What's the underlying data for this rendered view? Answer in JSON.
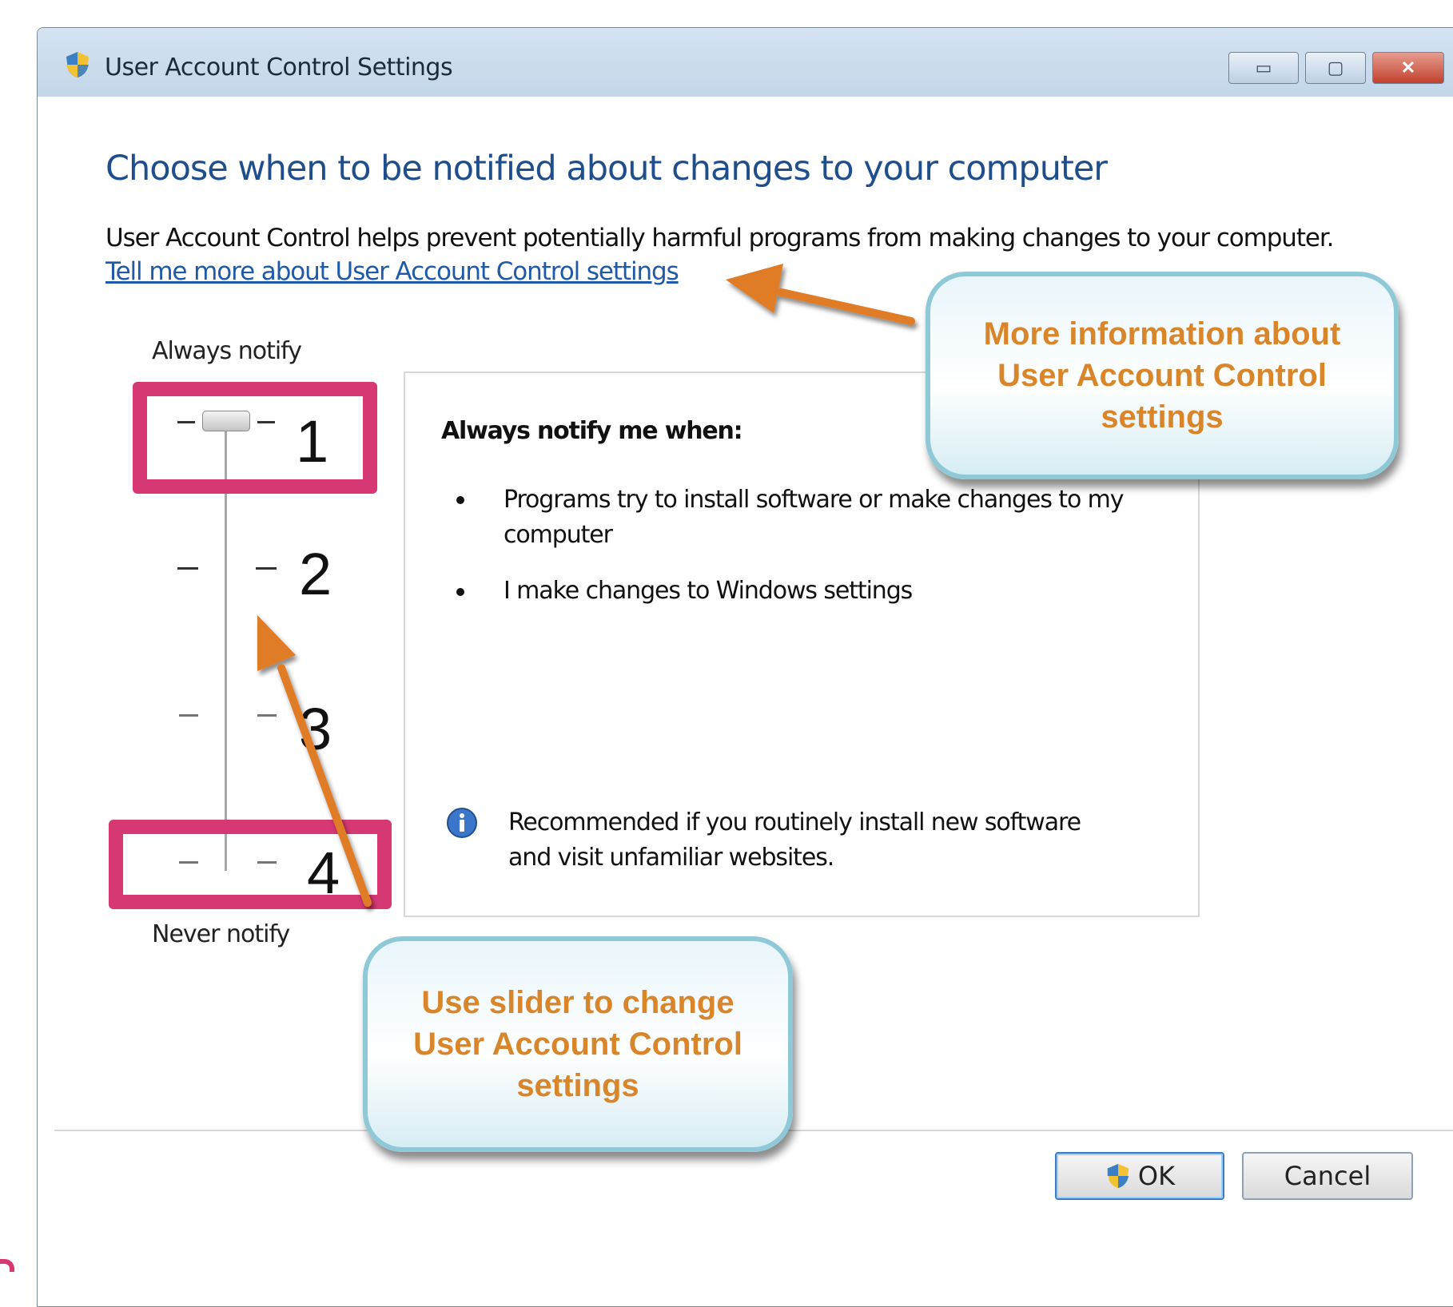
{
  "window": {
    "title": "User Account Control Settings",
    "controls": {
      "minimize": "▭",
      "maximize": "▢",
      "close": "✕"
    }
  },
  "heading": "Choose when to be notified about changes to your computer",
  "description": "User Account Control helps prevent potentially harmful programs from making changes to your computer.",
  "help_link": "Tell me more about User Account Control settings",
  "slider": {
    "top_label": "Always notify",
    "bottom_label": "Never notify",
    "selected_level": 1,
    "levels": [
      "1",
      "2",
      "3",
      "4"
    ]
  },
  "info_panel": {
    "heading": "Always notify me when:",
    "bullets": [
      "Programs try to install software or make changes to my computer",
      "I make changes to Windows settings"
    ],
    "recommendation": "Recommended if you routinely install new software and visit unfamiliar websites."
  },
  "buttons": {
    "ok": "OK",
    "cancel": "Cancel"
  },
  "callouts": {
    "more_info": "More information about User Account Control settings",
    "slider_hint": "Use slider to change User Account Control settings"
  },
  "colors": {
    "heading": "#1f4e8c",
    "link": "#1e5aa8",
    "highlight": "#d63873",
    "callout_text": "#d9852a",
    "arrow": "#e07b27"
  },
  "icons": {
    "window": "uac-shield-icon",
    "info": "info-icon",
    "ok": "uac-shield-icon"
  }
}
